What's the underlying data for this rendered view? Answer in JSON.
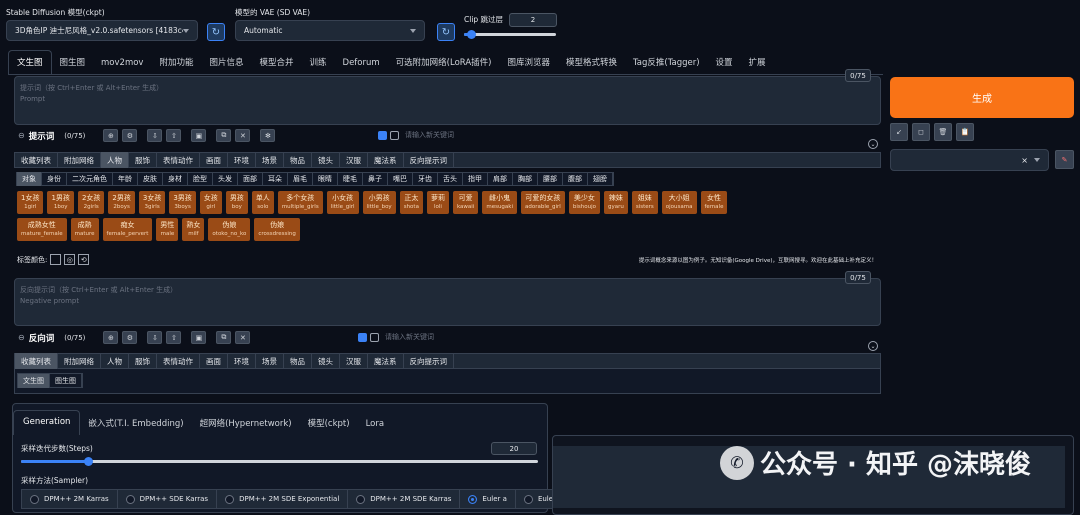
{
  "top": {
    "model_label": "Stable Diffusion 模型(ckpt)",
    "model_value": "3D角色IP 迪士尼风格_v2.0.safetensors [4183c4",
    "vae_label": "模型的 VAE (SD VAE)",
    "vae_value": "Automatic",
    "clip_label": "Clip 跳过层",
    "clip_value": "2",
    "clip_fraction": 0.08
  },
  "main_tabs": [
    "文生图",
    "图生图",
    "mov2mov",
    "附加功能",
    "图片信息",
    "模型合并",
    "训练",
    "Deforum",
    "可选附加网络(LoRA插件)",
    "图库浏览器",
    "模型格式转换",
    "Tag反推(Tagger)",
    "设置",
    "扩展"
  ],
  "prompt": {
    "placeholder_zh": "提示词（按 Ctrl+Enter 或 Alt+Enter 生成）",
    "placeholder_en": "Prompt",
    "counter": "0/75",
    "section_label": "提示词",
    "section_count": "(0/75)",
    "keyword_placeholder": "请输入新关键词"
  },
  "generate_label": "生成",
  "style_clear": "×",
  "categories": [
    "收藏列表",
    "附加网络",
    "人物",
    "服饰",
    "表情动作",
    "画面",
    "环境",
    "场景",
    "物品",
    "镜头",
    "汉服",
    "魔法系",
    "反向提示词"
  ],
  "subcategories": [
    "对象",
    "身份",
    "二次元角色",
    "年龄",
    "皮肤",
    "身材",
    "脸型",
    "头发",
    "面部",
    "耳朵",
    "眉毛",
    "眼睛",
    "睫毛",
    "鼻子",
    "嘴巴",
    "牙齿",
    "舌头",
    "指甲",
    "肩部",
    "胸部",
    "腰部",
    "腹部",
    "翅膀"
  ],
  "tags_row1": [
    {
      "zh": "1女孩",
      "en": "1girl"
    },
    {
      "zh": "1男孩",
      "en": "1boy"
    },
    {
      "zh": "2女孩",
      "en": "2girls"
    },
    {
      "zh": "2男孩",
      "en": "2boys"
    },
    {
      "zh": "3女孩",
      "en": "3girls"
    },
    {
      "zh": "3男孩",
      "en": "3boys"
    },
    {
      "zh": "女孩",
      "en": "girl"
    },
    {
      "zh": "男孩",
      "en": "boy"
    },
    {
      "zh": "单人",
      "en": "solo"
    },
    {
      "zh": "多个女孩",
      "en": "multiple_girls"
    },
    {
      "zh": "小女孩",
      "en": "little_girl"
    },
    {
      "zh": "小男孩",
      "en": "little_boy"
    },
    {
      "zh": "正太",
      "en": "shota"
    },
    {
      "zh": "萝莉",
      "en": "loli"
    },
    {
      "zh": "可爱",
      "en": "kawaii"
    },
    {
      "zh": "雌小鬼",
      "en": "mesugaki"
    },
    {
      "zh": "可爱的女孩",
      "en": "adorable_girl"
    },
    {
      "zh": "美少女",
      "en": "bishoujo"
    },
    {
      "zh": "辣妹",
      "en": "gyaru"
    },
    {
      "zh": "姐妹",
      "en": "sisters"
    },
    {
      "zh": "大小姐",
      "en": "ojousama"
    },
    {
      "zh": "女性",
      "en": "female"
    }
  ],
  "tags_row2": [
    {
      "zh": "成熟女性",
      "en": "mature_female"
    },
    {
      "zh": "成熟",
      "en": "mature"
    },
    {
      "zh": "痴女",
      "en": "female_pervert"
    },
    {
      "zh": "男性",
      "en": "male"
    },
    {
      "zh": "熟女",
      "en": "milf"
    },
    {
      "zh": "伪娘",
      "en": "otoko_no_ko"
    },
    {
      "zh": "伪娘",
      "en": "crossdressing"
    }
  ],
  "tag_color_label": "标签颜色:",
  "notice": "提示词概念来源以图为例子。无知识备(Google Drive)，互联网搜寻。欢迎在此基础上补充定义！",
  "negative": {
    "placeholder_zh": "反向提示词（按 Ctrl+Enter 或 Alt+Enter 生成）",
    "placeholder_en": "Negative prompt",
    "counter": "0/75",
    "section_label": "反向词",
    "section_count": "(0/75)",
    "keyword_placeholder": "请输入新关键词"
  },
  "neg_subtabs": [
    "文生图",
    "图生图"
  ],
  "gen_tabs": [
    "Generation",
    "嵌入式(T.I. Embedding)",
    "超网络(Hypernetwork)",
    "模型(ckpt)",
    "Lora"
  ],
  "steps": {
    "label": "采样迭代步数(Steps)",
    "value": "20",
    "fraction": 0.13
  },
  "sampler": {
    "label": "采样方法(Sampler)",
    "options": [
      "DPM++ 2M Karras",
      "DPM++ SDE Karras",
      "DPM++ 2M SDE Exponential",
      "DPM++ 2M SDE Karras",
      "Euler a",
      "Euler"
    ],
    "selected": "Euler a"
  },
  "watermark": {
    "text": "公众号 · 知乎 @沫晓俊"
  },
  "colors": {
    "accent": "#f97316",
    "tag": "#9a4b16",
    "bg": "#0b0f19"
  }
}
